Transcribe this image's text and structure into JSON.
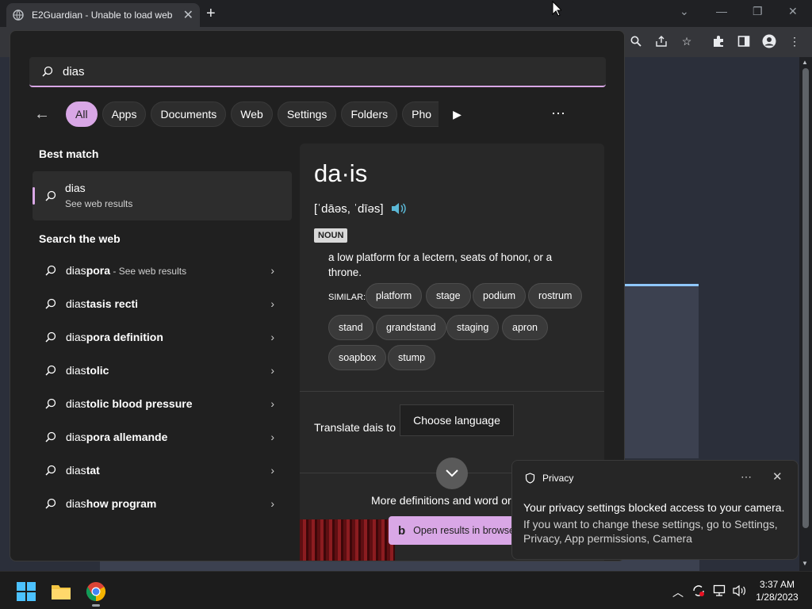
{
  "browser": {
    "tab_title": "E2Guardian - Unable to load web",
    "new_tab": "+",
    "close_tab": "✕"
  },
  "search": {
    "query": "dias",
    "filters": [
      "All",
      "Apps",
      "Documents",
      "Web",
      "Settings",
      "Folders"
    ],
    "truncated_filter": "Pho",
    "more": "⋯"
  },
  "results": {
    "best_match_title": "Best match",
    "best_match": {
      "term": "dias",
      "sub": "See web results"
    },
    "web_title": "Search the web",
    "web_items": [
      {
        "prefix": "dias",
        "rest": "pora",
        "sub": " - See web results"
      },
      {
        "prefix": "dias",
        "rest": "tasis recti",
        "sub": ""
      },
      {
        "prefix": "dias",
        "rest": "pora definition",
        "sub": ""
      },
      {
        "prefix": "dias",
        "rest": "tolic",
        "sub": ""
      },
      {
        "prefix": "dias",
        "rest": "tolic blood pressure",
        "sub": ""
      },
      {
        "prefix": "dias",
        "rest": "pora allemande",
        "sub": ""
      },
      {
        "prefix": "dias",
        "rest": "tat",
        "sub": ""
      },
      {
        "prefix": "dias",
        "rest": "how program",
        "sub": ""
      }
    ]
  },
  "dictionary": {
    "word": "da·is",
    "pronunciation": "[ˈdāəs, ˈdīəs]",
    "pos": "NOUN",
    "definition": "a low platform for a lectern, seats of honor, or a throne.",
    "similar_label": "SIMILAR:",
    "synonyms": [
      "platform",
      "stage",
      "podium",
      "rostrum",
      "stand",
      "grandstand",
      "staging",
      "apron",
      "soapbox",
      "stump"
    ],
    "translate_label": "Translate dais to",
    "choose_language": "Choose language",
    "more_definitions": "More definitions and word or",
    "open_results": "Open results in browse"
  },
  "toast": {
    "title": "Privacy",
    "more": "⋯",
    "close": "✕",
    "line1": "Your privacy settings blocked access to your camera.",
    "line2": "If you want to change these settings, go to Settings, Privacy, App permissions, Camera"
  },
  "taskbar": {
    "time": "3:37 AM",
    "date": "1/28/2023"
  },
  "colors": {
    "accent": "#d9a7e6",
    "panel": "#202020",
    "taskbar": "#1c1c1c"
  }
}
